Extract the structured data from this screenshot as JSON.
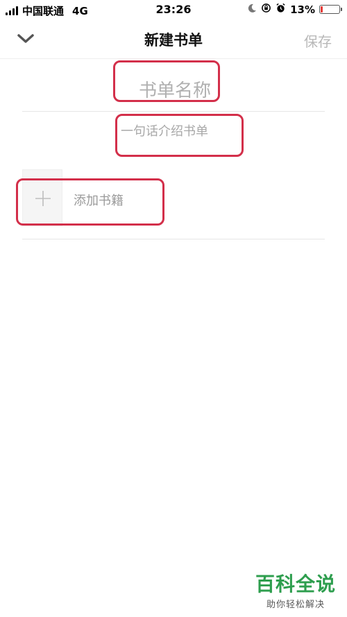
{
  "status_bar": {
    "carrier": "中国联通",
    "network": "4G",
    "time": "23:26",
    "battery_percent": "13%",
    "battery_level": 0.13,
    "icons": [
      "signal-icon",
      "moon-icon",
      "rotation-lock-icon",
      "alarm-icon",
      "battery-icon"
    ]
  },
  "nav": {
    "title": "新建书单",
    "save_label": "保存",
    "back_icon": "chevron-down-icon"
  },
  "form": {
    "name_placeholder": "书单名称",
    "name_value": "",
    "intro_placeholder": "一句话介绍书单",
    "intro_value": "",
    "add_book_label": "添加书籍",
    "add_icon": "plus-icon"
  },
  "watermark": {
    "logo_text": "百科全说",
    "tagline": "助你轻松解决"
  },
  "colors": {
    "annotation": "#d32f4a",
    "watermark_green": "#2e9e4e",
    "battery_low": "#e53935",
    "save_disabled": "#b8b8b8"
  }
}
